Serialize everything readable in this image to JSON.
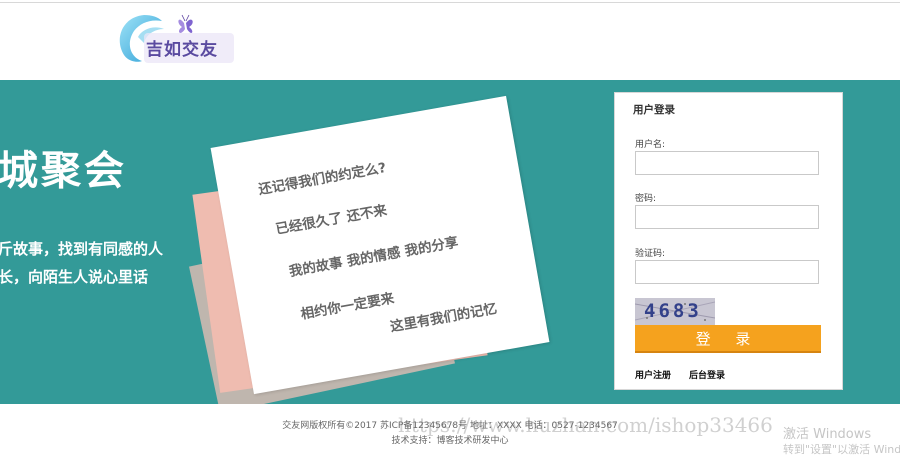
{
  "header": {
    "logo_text": "吉如交友"
  },
  "banner": {
    "slogan": "城聚会",
    "desc_line1": "斤故事，找到有同感的人",
    "desc_line2": "长，向陌生人说心里话",
    "note_lines": [
      "还记得我们的约定么?",
      "已经很久了  还不来",
      "我的故事  我的情感  我的分享",
      "相约你一定要来",
      "这里有我们的记忆"
    ]
  },
  "login": {
    "title": "用户登录",
    "username_label": "用户名:",
    "username_value": "",
    "password_label": "密码:",
    "password_value": "",
    "captcha_label": "验证码:",
    "captcha_value": "",
    "captcha_text": "4683",
    "submit_label": "登 录",
    "register_link": "用户注册",
    "admin_link": "后台登录"
  },
  "footer": {
    "copyright": "交友网版权所有©2017 苏ICP备12345678号 地址：XXXX 电话：0527-1234567",
    "tech_support": "技术支持：博客技术研发中心"
  },
  "overlay": {
    "watermark": "https://www.huzhan.com/ishop33466",
    "windows_line1": "激活 Windows",
    "windows_line2": "转到\"设置\"以激活 Windows。"
  },
  "colors": {
    "banner": "#339a98",
    "login_button": "#f5a21e",
    "captcha_digits": "#33418a"
  }
}
